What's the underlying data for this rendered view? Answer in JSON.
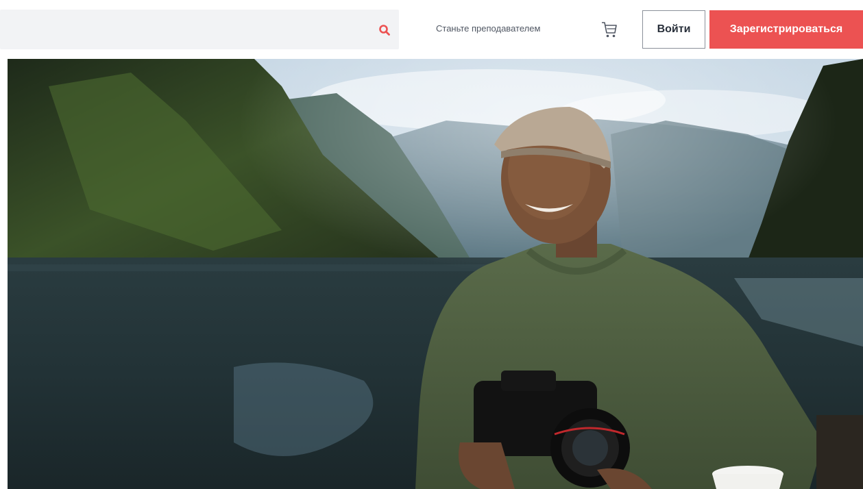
{
  "header": {
    "search": {
      "placeholder": "",
      "value": "",
      "icon": "search-icon"
    },
    "teach_label": "Станьте преподавателем",
    "cart_icon": "cart-icon",
    "login_label": "Войти",
    "signup_label": "Зарегистрироваться"
  },
  "hero": {
    "image_alt": "hero-banner-photo"
  },
  "colors": {
    "brand_red": "#ec5252",
    "search_bg": "#f2f3f5",
    "text_dark": "#29303b",
    "text_muted": "#505763"
  }
}
